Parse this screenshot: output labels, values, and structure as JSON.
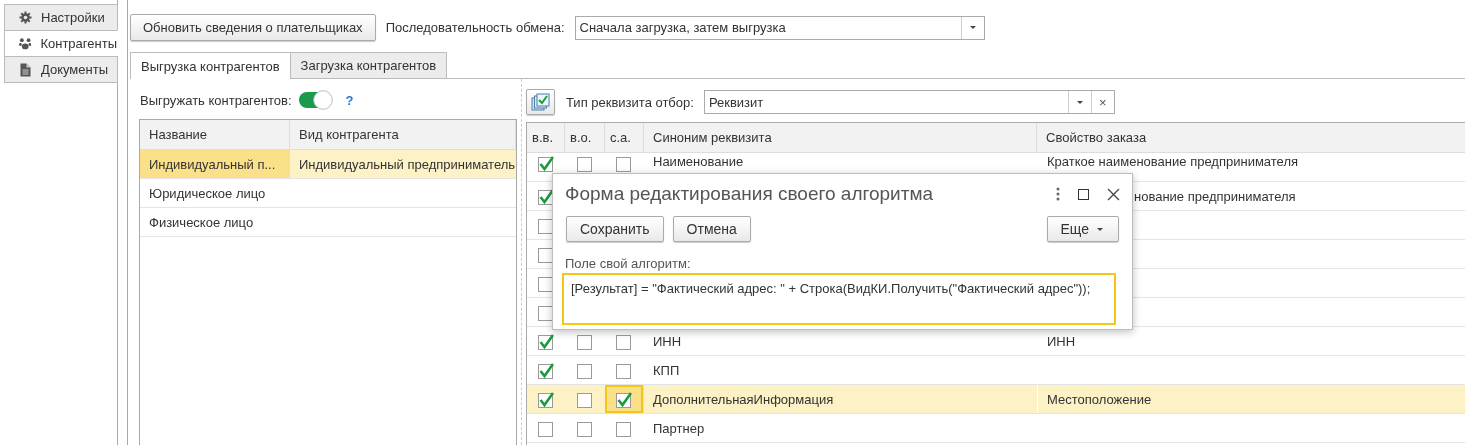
{
  "sidebar": {
    "items": [
      {
        "label": "Настройки",
        "selected": false
      },
      {
        "label": "Контрагенты",
        "selected": true
      },
      {
        "label": "Документы",
        "selected": false
      }
    ]
  },
  "toolbar": {
    "refresh_button": "Обновить сведения о плательщиках",
    "exchange_order": {
      "label": "Последовательность обмена:",
      "value": "Сначала загрузка, затем выгрузка"
    }
  },
  "tabs": [
    {
      "label": "Выгрузка контрагентов",
      "selected": true
    },
    {
      "label": "Загрузка контрагентов",
      "selected": false
    }
  ],
  "counterparties": {
    "export_toggle": {
      "label": "Выгружать контрагентов:",
      "on": true,
      "help": "?"
    },
    "columns": [
      "Название",
      "Вид контрагента"
    ],
    "rows": [
      {
        "name": "Индивидуальный п...",
        "counterparty_type": "Индивидуальный предприниматель",
        "selected": true,
        "name_focused": true
      },
      {
        "name": "Юридическое лицо",
        "selected": false
      },
      {
        "name": "Физическое лицо",
        "selected": false
      }
    ]
  },
  "attributes": {
    "filter": {
      "label": "Тип реквизита отбор:",
      "value": "Реквизит",
      "clear": "×"
    },
    "columns": [
      "в.в.",
      "в.о.",
      "с.а.",
      "Синоним реквизита",
      "Свойство заказа"
    ],
    "rows": [
      {
        "vv": true,
        "vo": false,
        "sa": false,
        "name": "Наименование",
        "property": "Краткое наименование предпринимателя",
        "selected": false
      },
      {
        "vv": true,
        "property": "нование предпринимателя",
        "property_covered": true,
        "selected": false
      },
      {
        "vv": false,
        "selected": false
      },
      {
        "vv": false,
        "selected": false
      },
      {
        "vv": false,
        "selected": false
      },
      {
        "vv": false,
        "selected": false
      },
      {
        "vv": true,
        "vo": false,
        "sa": false,
        "name": "ИНН",
        "property": "ИНН",
        "selected": false
      },
      {
        "vv": true,
        "vo": false,
        "sa": false,
        "name": "КПП",
        "selected": false
      },
      {
        "vv": true,
        "vo": false,
        "sa": true,
        "name": "ДополнительнаяИнформация",
        "property": "Местоположение",
        "selected": true,
        "sa_focused": true
      },
      {
        "vv": false,
        "vo": false,
        "sa": false,
        "name": "Партнер",
        "selected": false
      }
    ]
  },
  "dialog": {
    "title": "Форма редактирования своего алгоритма",
    "buttons": [
      "Сохранить",
      "Отмена"
    ],
    "more_button": "Еще",
    "field_label": "Поле свой алгоритм:",
    "field_value": "[Результат] = \"Фактический адрес: \" + Строка(ВидКИ.Получить(\"Фактический адрес\"));",
    "field_focused": true
  }
}
